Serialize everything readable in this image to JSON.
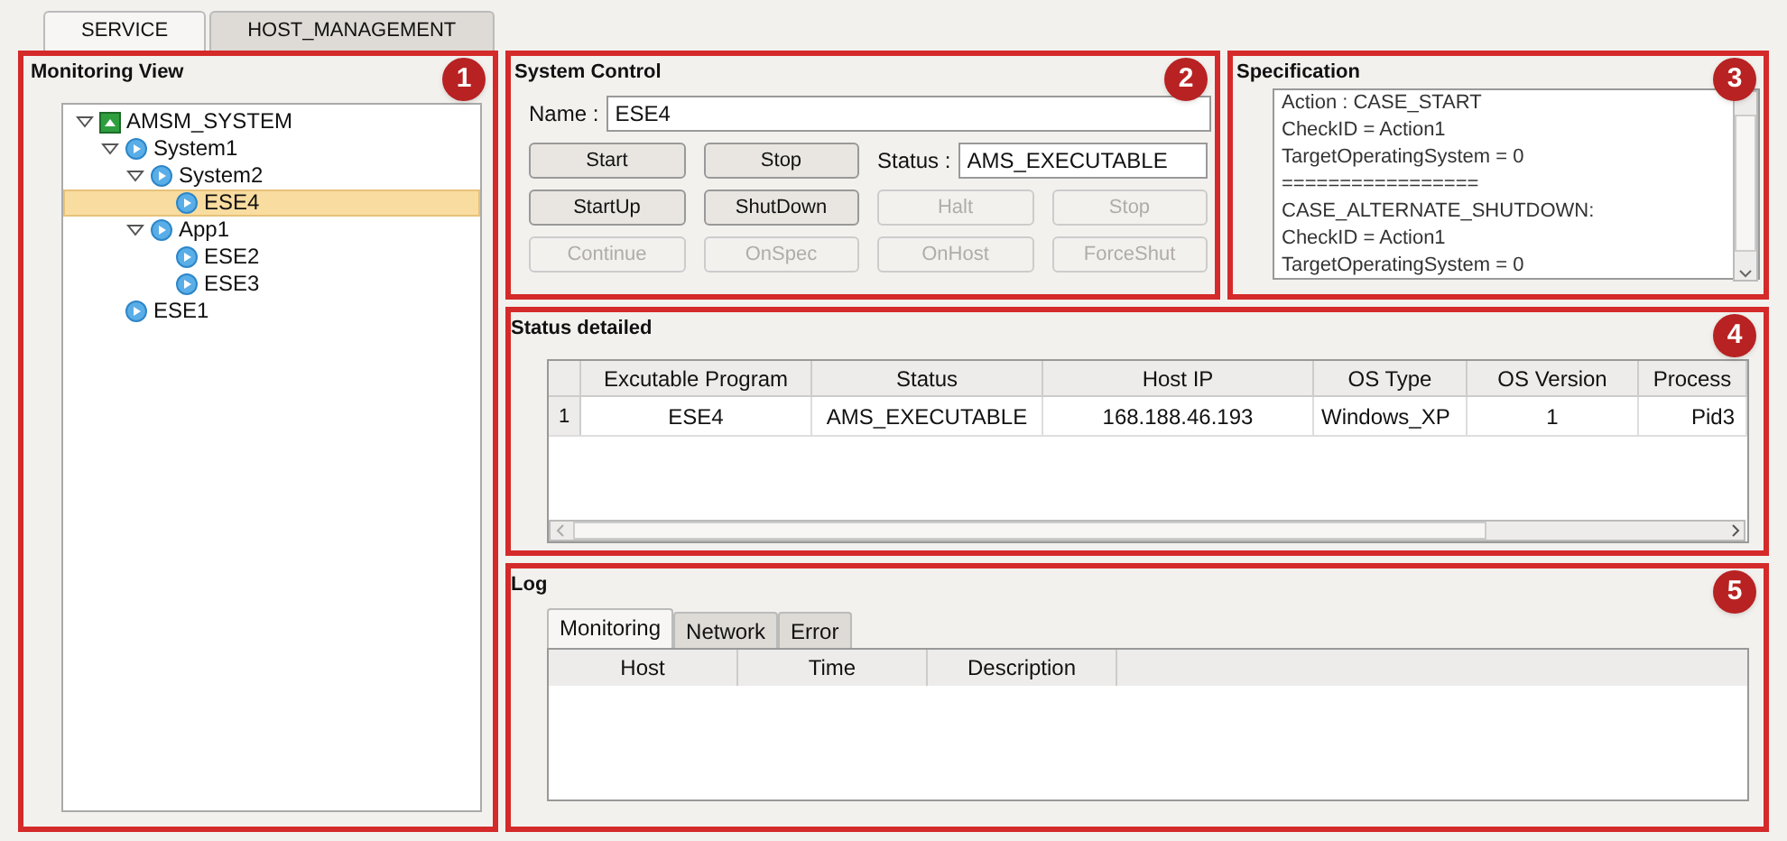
{
  "tabs": [
    {
      "label": "SERVICE",
      "selected": true
    },
    {
      "label": "HOST_MANAGEMENT",
      "selected": false
    }
  ],
  "monitoring_view": {
    "title": "Monitoring View",
    "badge": "1",
    "tree": [
      {
        "label": "AMSM_SYSTEM",
        "kind": "root",
        "expanded": true,
        "selected": false,
        "children": [
          {
            "label": "System1",
            "kind": "node",
            "expanded": true,
            "selected": false,
            "children": [
              {
                "label": "System2",
                "kind": "node",
                "expanded": true,
                "selected": false,
                "children": [
                  {
                    "label": "ESE4",
                    "kind": "node",
                    "selected": true
                  }
                ]
              },
              {
                "label": "App1",
                "kind": "node",
                "expanded": true,
                "selected": false,
                "children": [
                  {
                    "label": "ESE2",
                    "kind": "node",
                    "selected": false
                  },
                  {
                    "label": "ESE3",
                    "kind": "node",
                    "selected": false
                  }
                ]
              }
            ]
          },
          {
            "label": "ESE1",
            "kind": "node",
            "selected": false
          }
        ]
      }
    ]
  },
  "system_control": {
    "title": "System Control",
    "badge": "2",
    "name_label": "Name :",
    "name_value": "ESE4",
    "status_label": "Status :",
    "status_value": "AMS_EXECUTABLE",
    "button_rows": [
      [
        {
          "label": "Start",
          "disabled": false
        },
        {
          "label": "Stop",
          "disabled": false
        }
      ],
      [
        {
          "label": "StartUp",
          "disabled": false
        },
        {
          "label": "ShutDown",
          "disabled": false
        },
        {
          "label": "Halt",
          "disabled": true
        },
        {
          "label": "Stop",
          "disabled": true
        }
      ],
      [
        {
          "label": "Continue",
          "disabled": true
        },
        {
          "label": "OnSpec",
          "disabled": true
        },
        {
          "label": "OnHost",
          "disabled": true
        },
        {
          "label": "ForceShut",
          "disabled": true
        }
      ]
    ]
  },
  "specification": {
    "title": "Specification",
    "badge": "3",
    "lines": [
      "Action : CASE_START",
      "CheckID = Action1",
      "TargetOperatingSystem = 0",
      "=================",
      "CASE_ALTERNATE_SHUTDOWN:",
      "CheckID = Action1",
      "TargetOperatingSystem = 0"
    ]
  },
  "status_detailed": {
    "title": "Status detailed",
    "badge": "4",
    "columns": [
      "Excutable Program",
      "Status",
      "Host IP",
      "OS Type",
      "OS Version",
      "Process"
    ],
    "rows": [
      {
        "number": "1",
        "cells": [
          "ESE4",
          "AMS_EXECUTABLE",
          "168.188.46.193",
          "Windows_XP",
          "1",
          "Pid3"
        ]
      }
    ]
  },
  "log": {
    "title": "Log",
    "badge": "5",
    "tabs": [
      {
        "label": "Monitoring",
        "selected": true
      },
      {
        "label": "Network",
        "selected": false
      },
      {
        "label": "Error",
        "selected": false
      }
    ],
    "columns": [
      "Host",
      "Time",
      "Description"
    ]
  }
}
